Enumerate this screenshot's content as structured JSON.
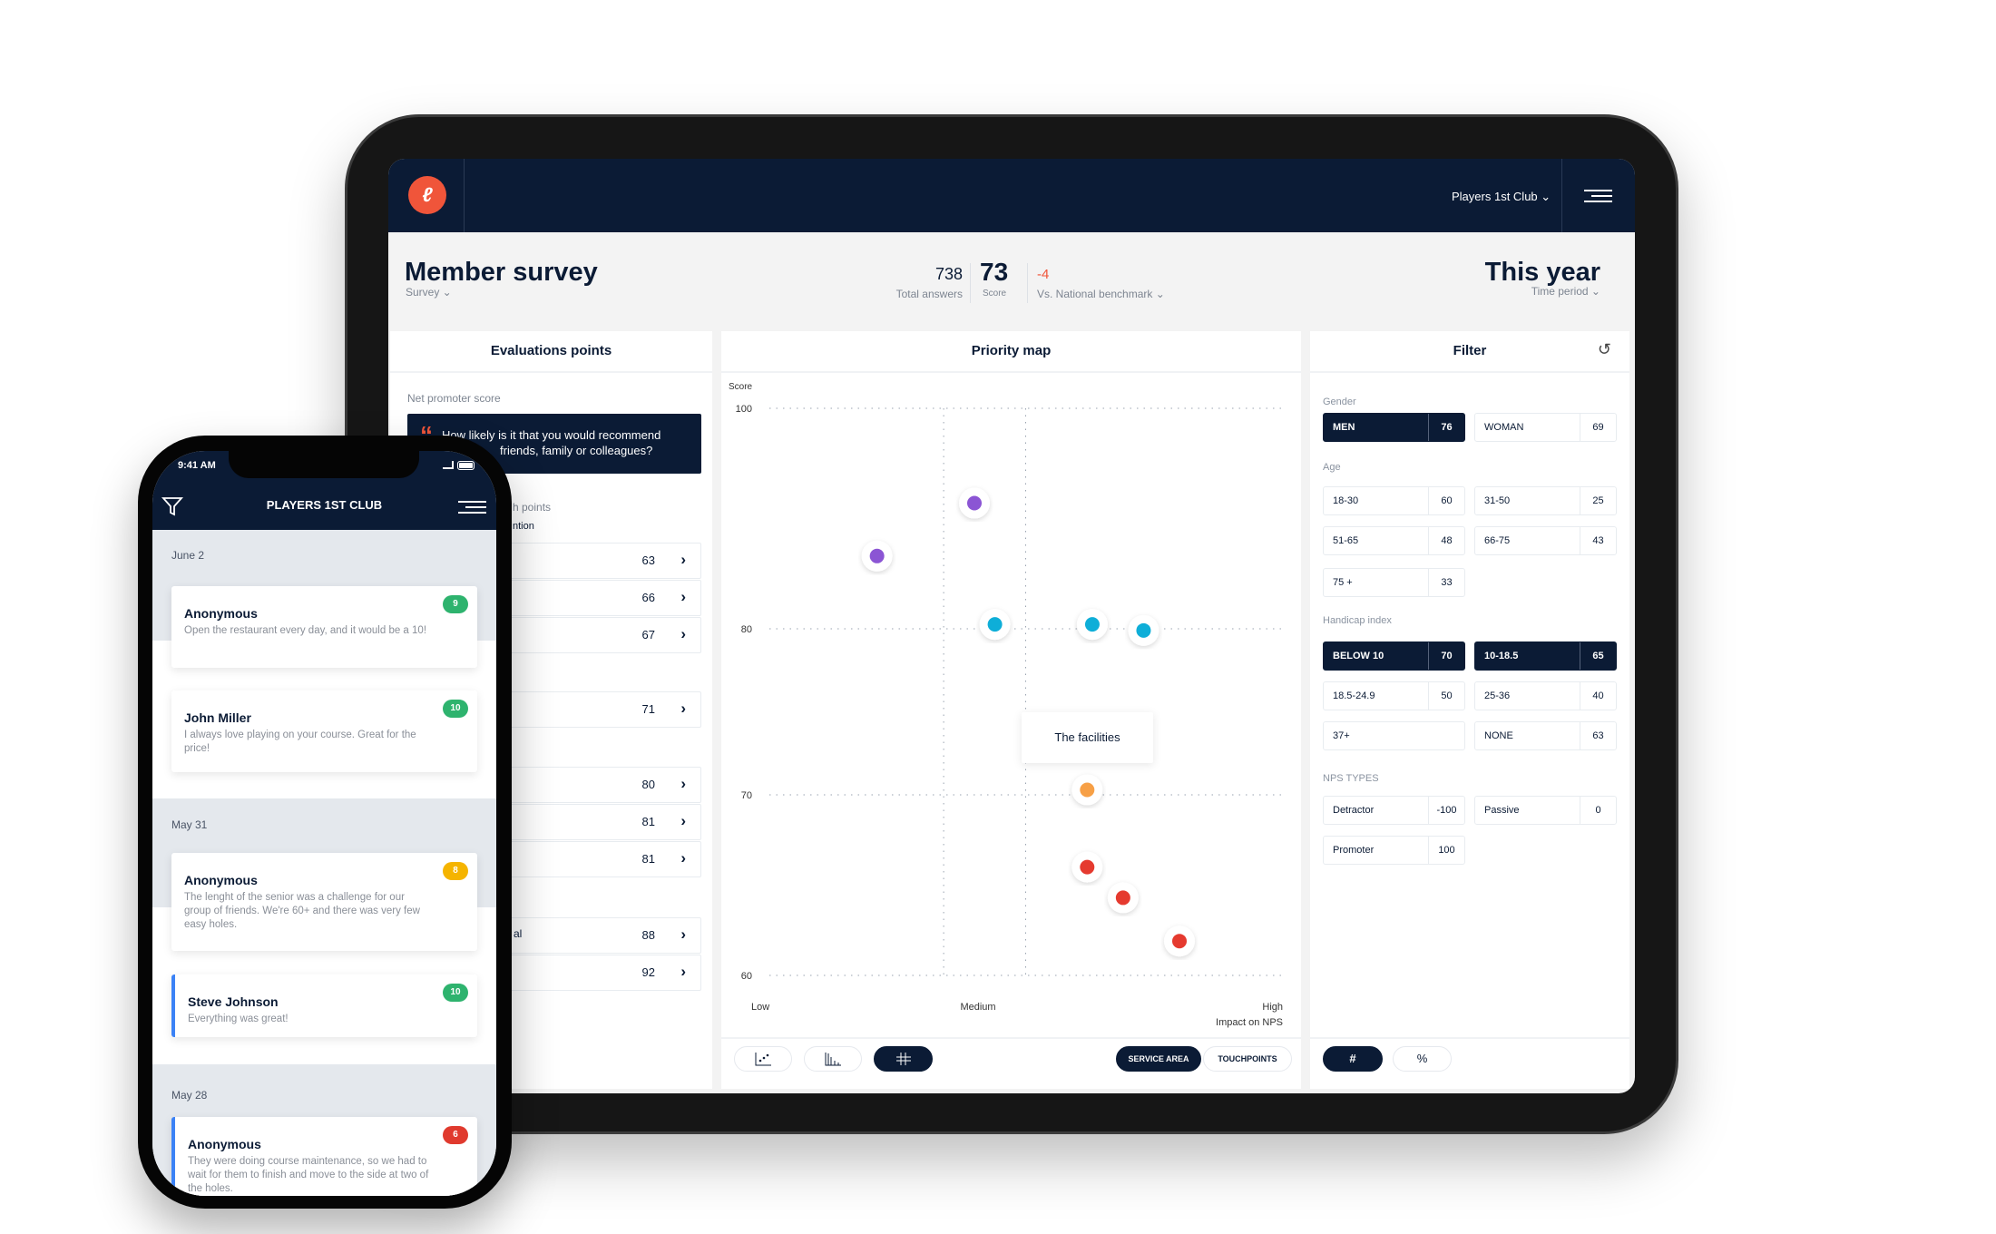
{
  "app": {
    "club_selector": "Players 1st Club ⌄",
    "logo": "P1"
  },
  "survey": {
    "title": "Member survey",
    "selector": "Survey ⌄",
    "total_answers": "738",
    "total_answers_label": "Total answers",
    "score": "73",
    "score_label": "Score",
    "benchmark_delta": "-4",
    "benchmark_label": "Vs. National benchmark ⌄",
    "period": "This year",
    "period_label": "Time period ⌄"
  },
  "evaluation": {
    "title": "Evaluations points",
    "nps_label": "Net promoter score",
    "question_line1": "How likely is it that you would recommend",
    "question_line2": "friends, family or colleagues?",
    "fragment_points": "h points",
    "fragment_attention": "ntion",
    "fragment_al": "al",
    "rows": [
      {
        "value": "63"
      },
      {
        "value": "66"
      },
      {
        "value": "67"
      },
      {
        "value": "71"
      },
      {
        "value": "80"
      },
      {
        "value": "81"
      },
      {
        "value": "81"
      },
      {
        "value": "88"
      },
      {
        "value": "92"
      }
    ]
  },
  "priority_map": {
    "title": "Priority map",
    "tooltip": "The facilities",
    "view_buttons": [
      "scatter-chart-icon",
      "bar-chart-icon",
      "grid-matrix-icon"
    ],
    "active_view": 2,
    "toggle": [
      "SERVICE AREA",
      "TOUCHPOINTS"
    ],
    "active_toggle": 0
  },
  "chart_data": {
    "type": "scatter",
    "ylabel": "Score",
    "xlabel": "Impact on NPS",
    "y_ticks": [
      100,
      80,
      70,
      60
    ],
    "x_tick_labels": [
      "Low",
      "Medium",
      "High"
    ],
    "x_dividers": [
      34,
      50
    ],
    "xlim": [
      0,
      100
    ],
    "ylim": [
      60,
      100
    ],
    "grid": true,
    "points": [
      {
        "x": 40,
        "y": 91.4,
        "color": "#8b55d4"
      },
      {
        "x": 21,
        "y": 86.6,
        "color": "#8b55d4"
      },
      {
        "x": 44,
        "y": 80.4,
        "color": "#0eaed8"
      },
      {
        "x": 63,
        "y": 80.4,
        "color": "#0eaed8"
      },
      {
        "x": 73,
        "y": 79.9,
        "color": "#0eaed8"
      },
      {
        "x": 62,
        "y": 70.3,
        "color": "#f7a046",
        "label": "The facilities"
      },
      {
        "x": 62,
        "y": 66,
        "color": "#e53a2f"
      },
      {
        "x": 69,
        "y": 64.3,
        "color": "#e53a2f"
      },
      {
        "x": 80,
        "y": 61.9,
        "color": "#e53a2f"
      }
    ]
  },
  "filter": {
    "title": "Filter",
    "groups": [
      {
        "label": "Gender",
        "chips": [
          {
            "label": "MEN",
            "value": "76",
            "on": true
          },
          {
            "label": "WOMAN",
            "value": "69"
          }
        ]
      },
      {
        "label": "Age",
        "chips": [
          {
            "label": "18-30",
            "value": "60"
          },
          {
            "label": "31-50",
            "value": "25"
          },
          {
            "label": "51-65",
            "value": "48"
          },
          {
            "label": "66-75",
            "value": "43"
          },
          {
            "label": "75 +",
            "value": "33"
          }
        ]
      },
      {
        "label": "Handicap index",
        "chips": [
          {
            "label": "BELOW 10",
            "value": "70",
            "on": true
          },
          {
            "label": "10-18.5",
            "value": "65",
            "on": true
          },
          {
            "label": "18.5-24.9",
            "value": "50"
          },
          {
            "label": "25-36",
            "value": "40"
          },
          {
            "label": "37+",
            "value": ""
          },
          {
            "label": "NONE",
            "value": "63"
          }
        ]
      },
      {
        "label": "NPS TYPES",
        "chips": [
          {
            "label": "Detractor",
            "value": "-100"
          },
          {
            "label": "Passive",
            "value": "0"
          },
          {
            "label": "Promoter",
            "value": "100"
          }
        ]
      }
    ],
    "mode": [
      "#",
      "%"
    ],
    "active_mode": 0
  },
  "phone": {
    "time": "9:41 AM",
    "title": "PLAYERS 1ST CLUB",
    "sections": [
      {
        "date": "June 2",
        "cards": [
          {
            "name": "Anonymous",
            "text": "Open the restaurant every day, and it would be a 10!",
            "score": "9",
            "color": "#2eb36e"
          },
          {
            "name": "John Miller",
            "text": "I always love playing on your course. Great for the price!",
            "score": "10",
            "color": "#2eb36e"
          }
        ]
      },
      {
        "date": "May 31",
        "cards": [
          {
            "name": "Anonymous",
            "text": "The lenght of the senior was a challenge for our group of friends. We're 60+ and there was very few easy holes.",
            "score": "8",
            "color": "#f5b400"
          },
          {
            "name": "Steve Johnson",
            "text": "Everything was great!",
            "score": "10",
            "color": "#2eb36e",
            "highlight": true
          }
        ]
      },
      {
        "date": "May 28",
        "cards": [
          {
            "name": "Anonymous",
            "text": "They were doing course maintenance, so we had to wait for them to finish and move to the side at two of the holes.",
            "score": "6",
            "color": "#e03a2e",
            "highlight": true
          }
        ]
      }
    ]
  }
}
